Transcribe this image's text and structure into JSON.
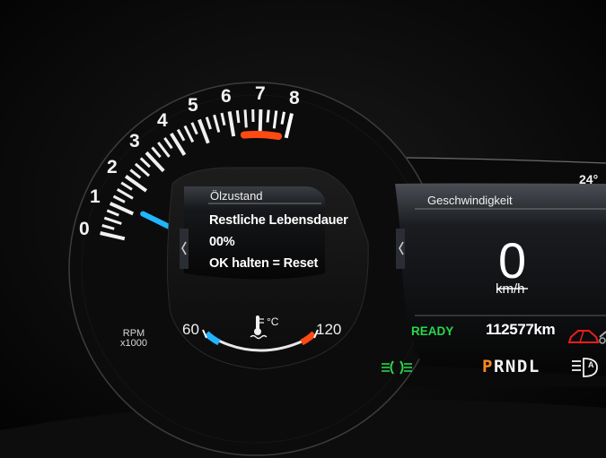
{
  "tachometer": {
    "scale_labels": [
      "0",
      "1",
      "2",
      "3",
      "4",
      "5",
      "6",
      "7",
      "8"
    ],
    "unit_line1": "RPM",
    "unit_line2": "x1000",
    "needle_value": 0,
    "redline_color": "#ff4a14",
    "needle_color": "#1fb6ff"
  },
  "oil_panel": {
    "title": "Ölzustand",
    "lines": [
      "Restliche Lebensdauer",
      "00%",
      "OK halten = Reset"
    ]
  },
  "coolant_gauge": {
    "min_label": "60",
    "max_label": "120",
    "unit": "°C",
    "icon": "coolant-temperature-icon",
    "cold_color": "#1fb6ff",
    "hot_color": "#ff4a14"
  },
  "speed_panel": {
    "title": "Geschwindigkeit",
    "value": "0",
    "unit": "km/h"
  },
  "outside_temp": "24°",
  "status": {
    "ready": "READY",
    "odometer": "112577km",
    "gears": [
      "P",
      "R",
      "N",
      "D",
      "L"
    ],
    "selected_gear": "P"
  },
  "indicators": {
    "parking_lights_color": "#27d94a",
    "door_ajar_color": "#e81e1e",
    "auto_highbeam": "A"
  }
}
